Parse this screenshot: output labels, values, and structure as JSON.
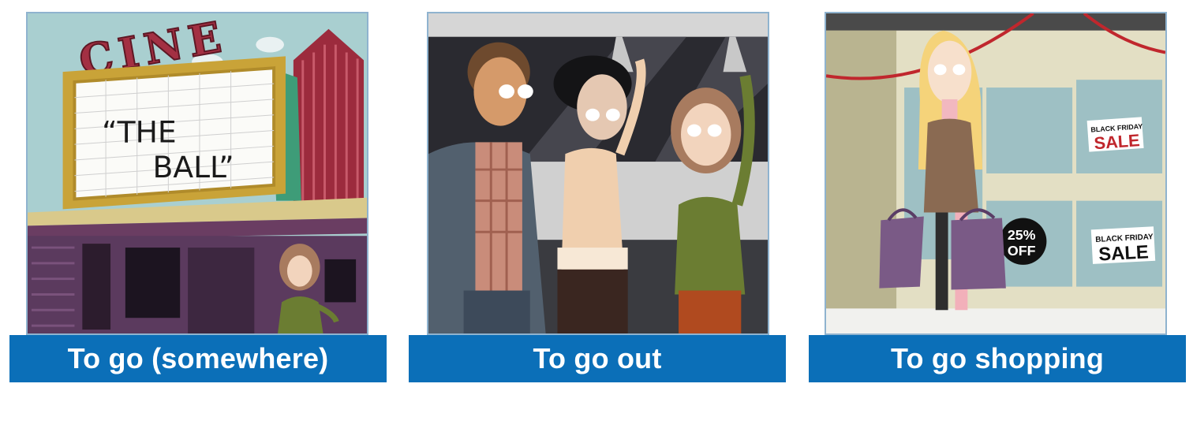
{
  "cards": [
    {
      "caption": "To go (somewhere)",
      "illustration": "cinema-scene",
      "sign": {
        "name": "CINE",
        "marquee_line1": "“THE",
        "marquee_line2": "BALL”"
      }
    },
    {
      "caption": "To go out",
      "illustration": "friends-on-bus-scene"
    },
    {
      "caption": "To go shopping",
      "illustration": "shopping-scene",
      "signs": {
        "bf_line1": "BLACK FRIDAY",
        "bf_line2": "SALE",
        "discount_line1": "25%",
        "discount_line2": "OFF"
      }
    }
  ],
  "colors": {
    "caption_bg": "#0b6fb8",
    "caption_text": "#ffffff",
    "frame": "#8fb3cf"
  }
}
